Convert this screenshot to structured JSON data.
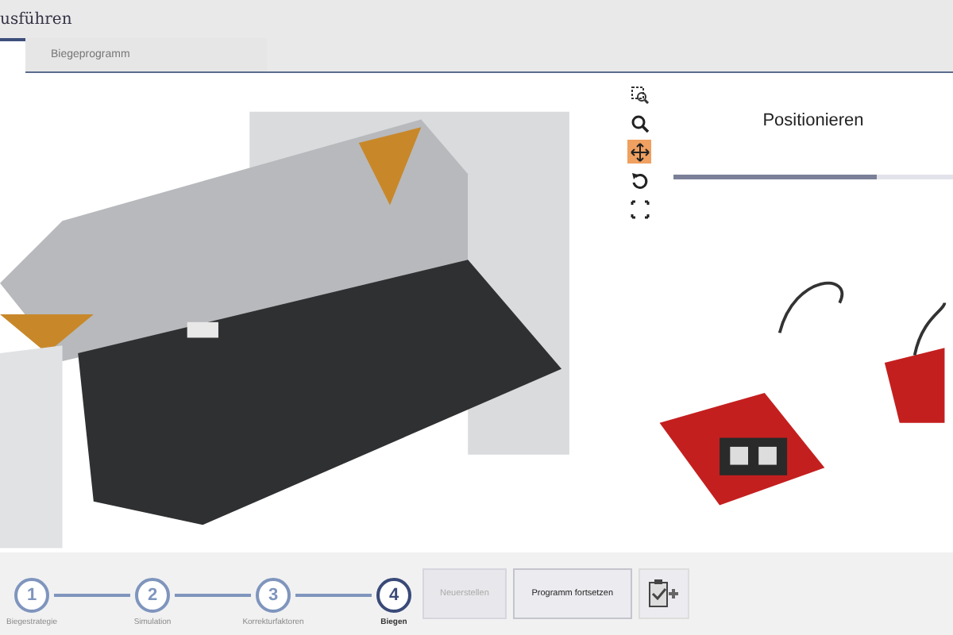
{
  "header": {
    "title": "usführen"
  },
  "tabs": [
    {
      "selected": true
    },
    {
      "label": "Biegeprogramm",
      "selected": false
    }
  ],
  "view_tools": [
    {
      "kind": "zoom-window",
      "selected": false
    },
    {
      "kind": "zoom",
      "selected": false
    },
    {
      "kind": "pan",
      "selected": true
    },
    {
      "kind": "rotate",
      "selected": false
    },
    {
      "kind": "fit",
      "selected": false
    }
  ],
  "panel": {
    "title": "Positionieren",
    "level": 0.73
  },
  "steps": [
    {
      "number": "1",
      "label": "Biegestrategie",
      "selected": false
    },
    {
      "number": "2",
      "label": "Simulation",
      "selected": false
    },
    {
      "number": "3",
      "label": "Korrekturfaktoren",
      "selected": false
    },
    {
      "number": "4",
      "label": "Biegen",
      "selected": true
    }
  ],
  "buttons": [
    {
      "label": "Neuerstellen",
      "disabled": true
    },
    {
      "label": "Programm fortsetzen",
      "disabled": false
    }
  ]
}
